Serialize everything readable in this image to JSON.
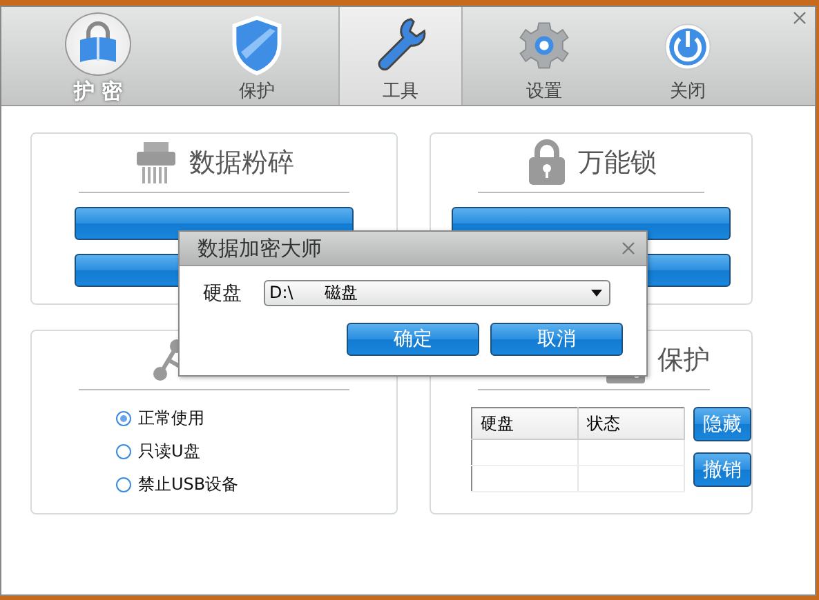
{
  "logo": {
    "label": "护 密"
  },
  "tabs": [
    {
      "label": "保护",
      "selected": false
    },
    {
      "label": "工具",
      "selected": true
    },
    {
      "label": "设置",
      "selected": false
    },
    {
      "label": "关闭",
      "selected": false
    }
  ],
  "shred": {
    "title": "数据粉碎"
  },
  "lock": {
    "title": "万能锁"
  },
  "usb": {
    "options": [
      {
        "label": "正常使用",
        "selected": true
      },
      {
        "label": "只读U盘",
        "selected": false
      },
      {
        "label": "禁止USB设备",
        "selected": false
      }
    ]
  },
  "disk": {
    "title": "保护",
    "columns": [
      "硬盘",
      "状态"
    ],
    "buttons": [
      "隐藏",
      "撤销"
    ]
  },
  "dialog": {
    "title": "数据加密大师",
    "field_label": "硬盘",
    "select_value": "D:\\      磁盘",
    "buttons": [
      "确定",
      "取消"
    ]
  }
}
